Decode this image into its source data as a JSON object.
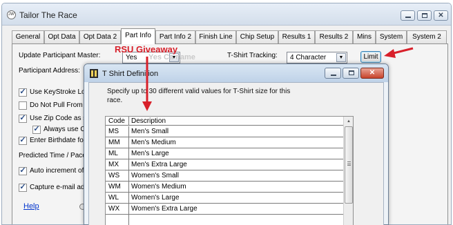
{
  "window": {
    "title": "Tailor The Race"
  },
  "tabs": [
    {
      "label": "General"
    },
    {
      "label": "Opt Data"
    },
    {
      "label": "Opt Data 2"
    },
    {
      "label": "Part Info"
    },
    {
      "label": "Part Info 2"
    },
    {
      "label": "Finish Line"
    },
    {
      "label": "Chip Setup"
    },
    {
      "label": "Results 1"
    },
    {
      "label": "Results 2"
    },
    {
      "label": "Mins"
    },
    {
      "label": "System"
    },
    {
      "label": "System 2"
    }
  ],
  "active_tab": "Part Info",
  "form": {
    "update_master_label": "Update Participant Master:",
    "update_master_value": "Yes",
    "tshirt_tracking_label": "T-Shirt Tracking:",
    "tshirt_tracking_value": "4 Character",
    "limit_button": "Limit",
    "participant_address_label": "Participant Address:",
    "checkboxes": [
      {
        "label": "Use KeyStroke Lo",
        "checked": true
      },
      {
        "label": "Do Not Pull From P",
        "checked": false
      },
      {
        "label": "Use Zip Code as s",
        "checked": true
      },
      {
        "label": "Always use C",
        "checked": true
      },
      {
        "label": "Enter Birthdate for",
        "checked": true
      },
      {
        "label": "Auto increment of",
        "checked": true
      },
      {
        "label": "Capture e-mail add",
        "checked": true
      }
    ],
    "predicted_time_label": "Predicted Time / Pace",
    "help_link": "Help"
  },
  "annotation": {
    "text": "RSU Giveaway",
    "ghost_text": "Yes  Ca  name"
  },
  "dialog": {
    "title": "T Shirt Definition",
    "description": "Specify up to 30 different valid values for T-Shirt size for this race.",
    "columns": {
      "code": "Code",
      "description": "Description"
    },
    "rows": [
      {
        "code": "MS",
        "description": "Men's Small"
      },
      {
        "code": "MM",
        "description": "Men's Medium"
      },
      {
        "code": "ML",
        "description": "Men's Large"
      },
      {
        "code": "MX",
        "description": "Men's Extra Large"
      },
      {
        "code": "WS",
        "description": "Women's Small"
      },
      {
        "code": "WM",
        "description": "Women's Medium"
      },
      {
        "code": "WL",
        "description": "Women's Large"
      },
      {
        "code": "WX",
        "description": "Women's Extra Large"
      },
      {
        "code": "",
        "description": ""
      }
    ]
  },
  "colors": {
    "annotation_red": "#d8202a",
    "link_blue": "#0033cc"
  }
}
